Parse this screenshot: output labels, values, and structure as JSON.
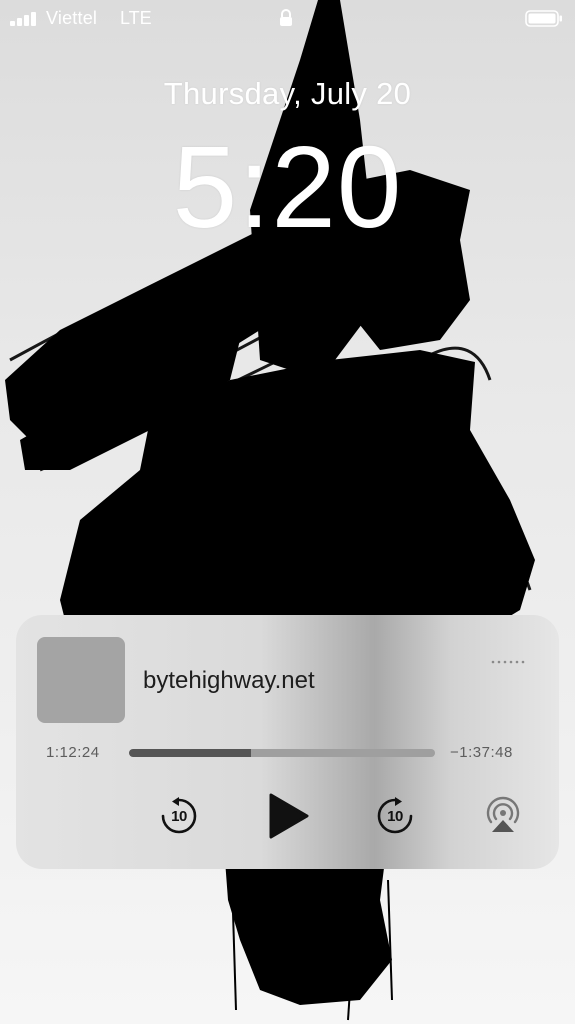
{
  "status_bar": {
    "carrier": "Viettel",
    "network": "LTE",
    "icons": [
      "signal-bars-icon",
      "lock-icon",
      "battery-icon"
    ]
  },
  "lock_screen": {
    "date": "Thursday, July 20",
    "time": "5:20"
  },
  "now_playing": {
    "title": "bytehighway.net",
    "elapsed": "1:12:24",
    "remaining": "−1:37:48",
    "progress_fraction": 0.4,
    "skip_back_seconds": "10",
    "skip_forward_seconds": "10",
    "controls": [
      "skip-back-10-icon",
      "play-icon",
      "skip-forward-10-icon",
      "airplay-icon",
      "more-icon"
    ]
  },
  "colors": {
    "background": "#e6e6e6",
    "wallpaper_ink": "#000000",
    "text_on_wallpaper": "#ffffff",
    "player_text": "#1e1e1e",
    "progress_track": "#9f9f9f",
    "progress_fill": "#555555"
  }
}
